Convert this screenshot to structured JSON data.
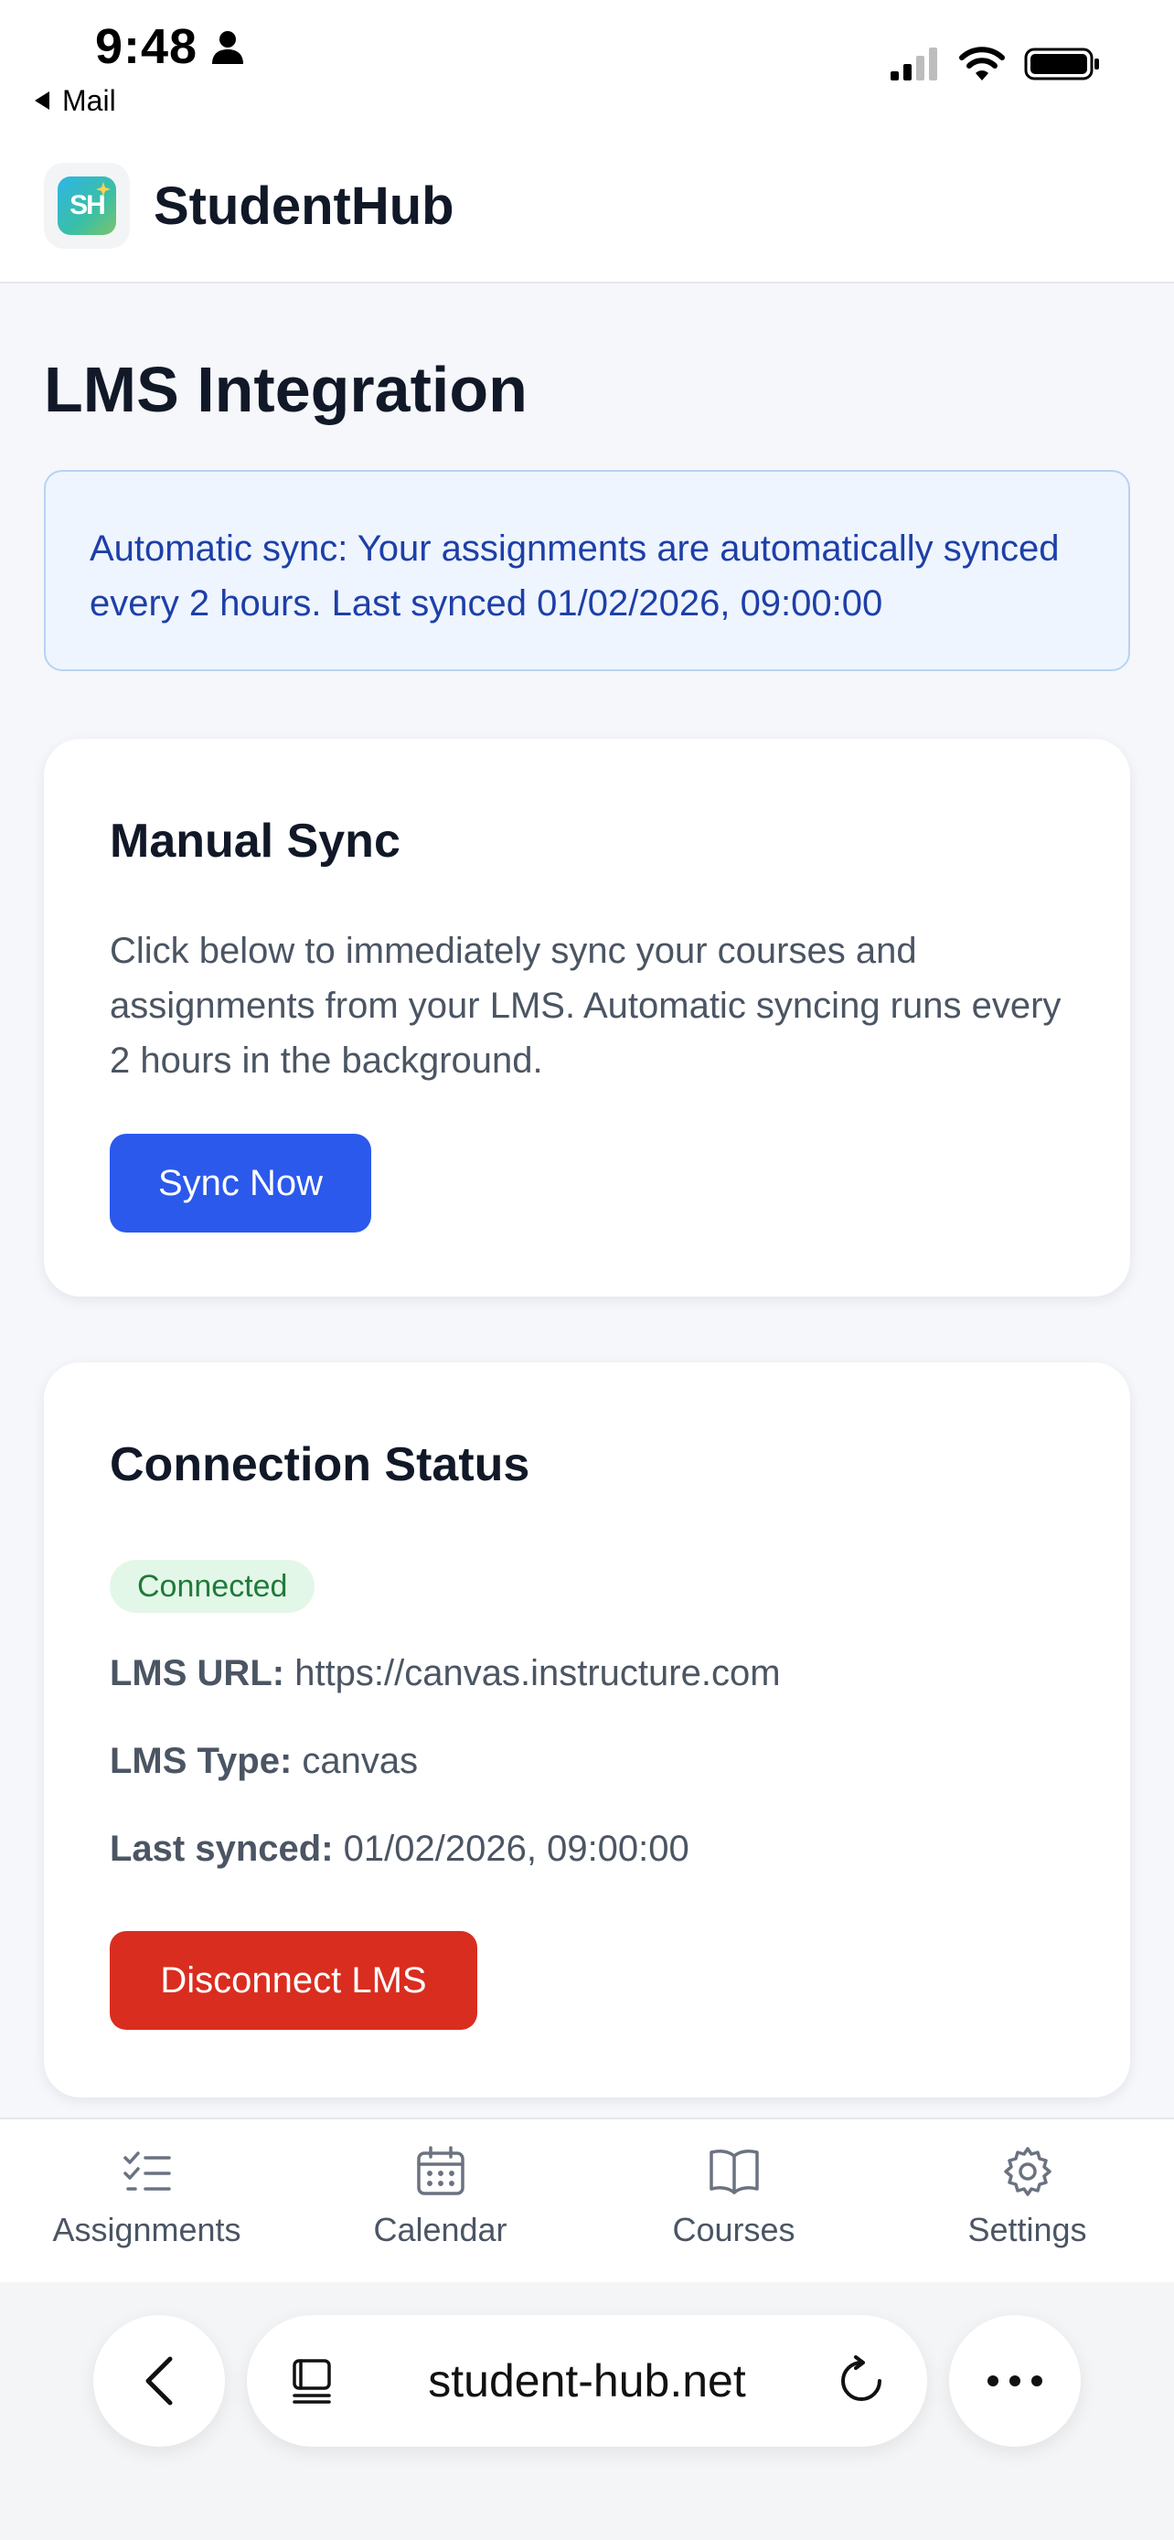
{
  "status_bar": {
    "time": "9:48",
    "back_app": "Mail"
  },
  "header": {
    "logo_text": "SH",
    "app_name": "StudentHub"
  },
  "page": {
    "title": "LMS Integration",
    "banner": "Automatic sync: Your assignments are automatically synced every 2 hours. Last synced 01/02/2026, 09:00:00"
  },
  "manual_sync": {
    "title": "Manual Sync",
    "description": "Click below to immediately sync your courses and assignments from your LMS. Automatic syncing runs every 2 hours in the background.",
    "button": "Sync Now"
  },
  "connection": {
    "title": "Connection Status",
    "status": "Connected",
    "url_label": "LMS URL:",
    "url_value": "https://canvas.instructure.com",
    "type_label": "LMS Type:",
    "type_value": "canvas",
    "synced_label": "Last synced:",
    "synced_value": "01/02/2026, 09:00:00",
    "disconnect_button": "Disconnect LMS"
  },
  "tab_bar": {
    "items": [
      {
        "label": "Assignments",
        "icon": "checklist-icon"
      },
      {
        "label": "Calendar",
        "icon": "calendar-icon"
      },
      {
        "label": "Courses",
        "icon": "book-icon"
      },
      {
        "label": "Settings",
        "icon": "gear-icon"
      }
    ]
  },
  "browser": {
    "address": "student-hub.net"
  },
  "colors": {
    "primary_button": "#2b59eb",
    "danger_button": "#d92d20",
    "banner_text": "#1e3fa8",
    "connected_badge_bg": "#e3f7e8",
    "connected_badge_text": "#1f7a3a"
  }
}
